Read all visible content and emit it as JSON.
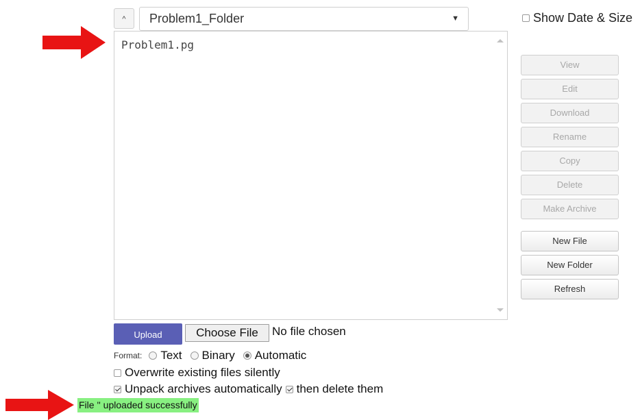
{
  "header": {
    "parent_button_label": "^",
    "folder_select_value": "Problem1_Folder",
    "show_date_size_label": "Show Date & Size",
    "show_date_size_checked": false
  },
  "file_list": {
    "items": [
      "Problem1.pg"
    ]
  },
  "actions": {
    "view": "View",
    "edit": "Edit",
    "download": "Download",
    "rename": "Rename",
    "copy": "Copy",
    "delete": "Delete",
    "make_archive": "Make Archive",
    "new_file": "New File",
    "new_folder": "New Folder",
    "refresh": "Refresh"
  },
  "upload": {
    "upload_label": "Upload",
    "choose_file_label": "Choose File",
    "no_file_label": "No file chosen",
    "format_label": "Format:",
    "format_options": [
      "Text",
      "Binary",
      "Automatic"
    ],
    "format_selected": "Automatic",
    "overwrite_label": "Overwrite existing files silently",
    "overwrite_checked": false,
    "unpack_label": "Unpack archives automatically",
    "unpack_checked": true,
    "delete_label": "then delete them",
    "delete_checked": true
  },
  "status": {
    "message": "File '' uploaded successfully"
  },
  "colors": {
    "upload_button": "#5a5fb5",
    "status_background": "#88f081",
    "arrow": "#e81414"
  }
}
